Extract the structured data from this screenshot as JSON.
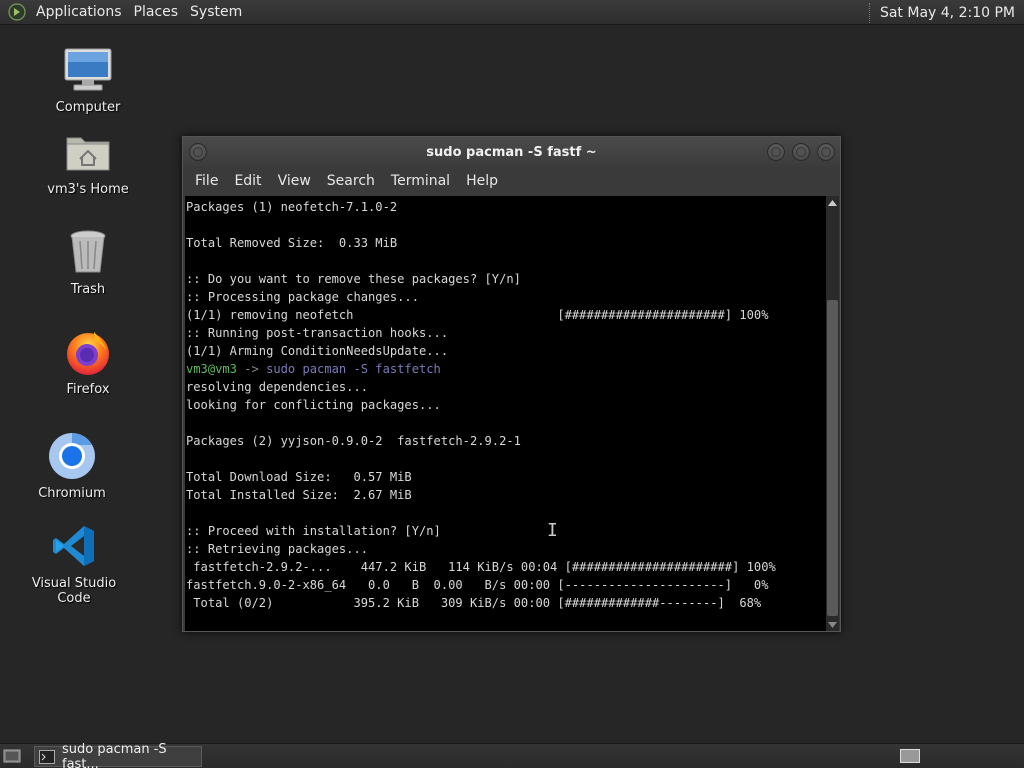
{
  "top_panel": {
    "menus": [
      "Applications",
      "Places",
      "System"
    ],
    "clock": "Sat May  4,  2:10 PM"
  },
  "desktop_icons": [
    {
      "label": "Computer",
      "icon": "computer-icon"
    },
    {
      "label": "vm3's Home",
      "icon": "home-folder-icon"
    },
    {
      "label": "Trash",
      "icon": "trash-icon"
    },
    {
      "label": "Firefox",
      "icon": "firefox-icon"
    },
    {
      "label": "Chromium",
      "icon": "chromium-icon"
    },
    {
      "label": "Visual Studio Code",
      "icon": "vscode-icon"
    }
  ],
  "window": {
    "title": "sudo pacman -S fastf ~",
    "menu": [
      "File",
      "Edit",
      "View",
      "Search",
      "Terminal",
      "Help"
    ]
  },
  "terminal": {
    "lines": [
      "Packages (1) neofetch-7.1.0-2",
      "",
      "Total Removed Size:  0.33 MiB",
      "",
      ":: Do you want to remove these packages? [Y/n]",
      ":: Processing package changes...",
      "(1/1) removing neofetch                            [######################] 100%",
      ":: Running post-transaction hooks...",
      "(1/1) Arming ConditionNeedsUpdate..."
    ],
    "prompt": {
      "user": "vm3@vm3",
      "arrow": " -> ",
      "command": "sudo pacman -S fastfetch"
    },
    "lines_after": [
      "resolving dependencies...",
      "looking for conflicting packages...",
      "",
      "Packages (2) yyjson-0.9.0-2  fastfetch-2.9.2-1",
      "",
      "Total Download Size:   0.57 MiB",
      "Total Installed Size:  2.67 MiB",
      "",
      ":: Proceed with installation? [Y/n]",
      ":: Retrieving packages...",
      " fastfetch-2.9.2-...    447.2 KiB   114 KiB/s 00:04 [######################] 100%",
      "fastfetch.9.0-2-x86_64   0.0   B  0.00   B/s 00:00 [----------------------]   0%",
      " Total (0/2)           395.2 KiB   309 KiB/s 00:00 [#############--------]  68%"
    ]
  },
  "taskbar": {
    "task_label": "sudo pacman -S fast..."
  },
  "colors": {
    "desktop_bg": "#262626",
    "terminal_bg": "#000000",
    "prompt_user": "#5fb95f",
    "prompt_command": "#7a7ab8"
  }
}
